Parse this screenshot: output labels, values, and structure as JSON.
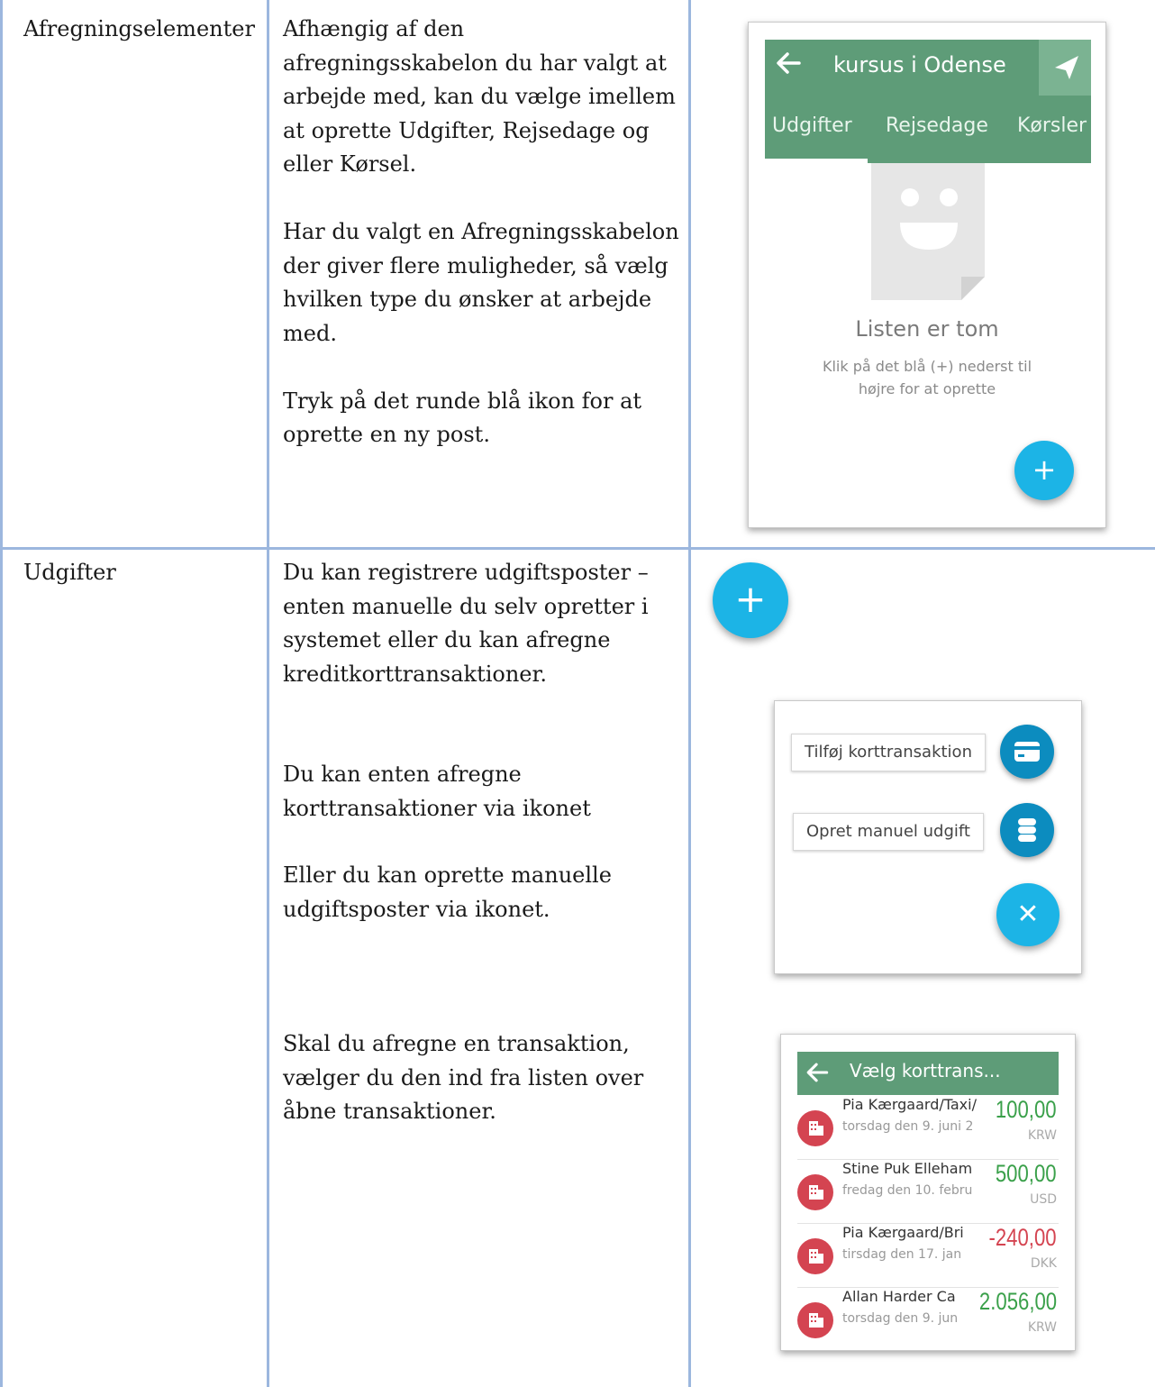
{
  "rows": [
    {
      "label": "Afregningselementer",
      "paragraphs": [
        "Afhængig af den afregningsskabelon du har valgt at arbejde med, kan du vælge imellem at oprette Udgifter, Rejsedage og eller Kørsel.",
        "Har du valgt en Afregningsskabelon der giver flere muligheder, så vælg hvilken type du ønsker at arbejde med.",
        "Tryk på det runde blå ikon for at oprette en ny post."
      ]
    },
    {
      "label": "Udgifter",
      "paragraphs": [
        "Du kan registrere udgiftsposter – enten manuelle du selv opretter i systemet eller du kan afregne kreditkorttransaktioner.",
        "Du kan enten afregne korttransaktioner via ikonet",
        "Eller du kan oprette manuelle udgiftsposter via ikonet.",
        "Skal du afregne en transaktion, vælger du den ind fra listen over åbne transaktioner."
      ]
    }
  ],
  "phone1": {
    "title": "kursus i Odense",
    "tabs": [
      "Udgifter",
      "Rejsedage",
      "Kørsler"
    ],
    "empty_title": "Listen er tom",
    "empty_line1": "Klik på det blå (+) nederst til",
    "empty_line2": "højre for at oprette",
    "fab_symbol": "+"
  },
  "fab_large": {
    "symbol": "+"
  },
  "menu": {
    "card_label": "Tilføj korttransaktion",
    "manual_label": "Opret manuel udgift",
    "close_symbol": "✕"
  },
  "list": {
    "title": "Vælg korttrans...",
    "items": [
      {
        "name": "Pia Kærgaard/Taxi/",
        "date": "torsdag den 9. juni 2",
        "amount": "100,00",
        "currency": "KRW",
        "color": "#3aa04a"
      },
      {
        "name": "Stine Puk Elleham",
        "date": "fredag den 10. febru",
        "amount": "500,00",
        "currency": "USD",
        "color": "#3aa04a"
      },
      {
        "name": "Pia Kærgaard/Bri",
        "date": "tirsdag den 17. jan",
        "amount": "-240,00",
        "currency": "DKK",
        "color": "#d44451"
      },
      {
        "name": "Allan Harder Ca",
        "date": "torsdag den 9. jun",
        "amount": "2.056,00",
        "currency": "KRW",
        "color": "#3aa04a"
      }
    ]
  },
  "colors": {
    "grid": "#9cb7de",
    "header_green": "#5e9c78",
    "fab_blue": "#1cb4e6",
    "menu_blue": "#0c8cbf",
    "avatar_red": "#d44451"
  }
}
